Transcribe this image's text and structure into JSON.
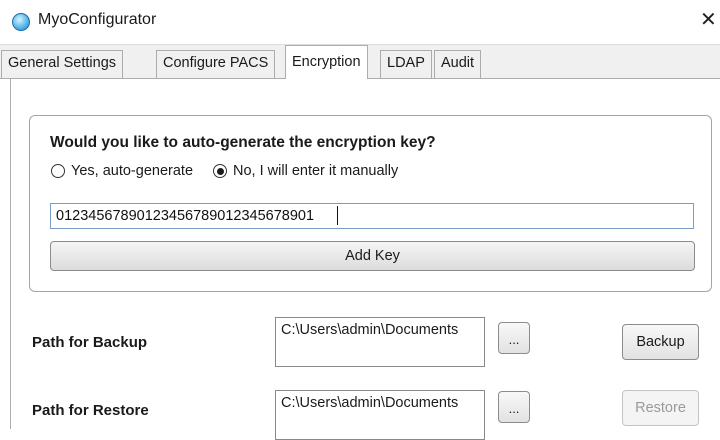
{
  "window": {
    "title": "MyoConfigurator",
    "app_icon": "myo-globe-icon",
    "close_label": "✕"
  },
  "tabs": [
    {
      "label": "General Settings",
      "active": false
    },
    {
      "label": "Configure PACS",
      "active": false
    },
    {
      "label": "Encryption",
      "active": true
    },
    {
      "label": "LDAP",
      "active": false
    },
    {
      "label": "Audit",
      "active": false
    }
  ],
  "encryption": {
    "question": "Would you like to auto-generate the encryption key?",
    "option_auto": "Yes, auto-generate",
    "option_manual": "No, I will enter it manually",
    "selected": "manual",
    "key_value": "01234567890123456789012345678901",
    "add_key_label": "Add Key"
  },
  "backup": {
    "label": "Path for Backup",
    "path": "C:\\Users\\admin\\Documents",
    "browse_label": "...",
    "button_label": "Backup",
    "enabled": true
  },
  "restore": {
    "label": "Path for Restore",
    "path": "C:\\Users\\admin\\Documents",
    "browse_label": "...",
    "button_label": "Restore",
    "enabled": false
  },
  "colors": {
    "input_border": "#7a9cc6",
    "disabled_text": "#9a9a9a"
  }
}
